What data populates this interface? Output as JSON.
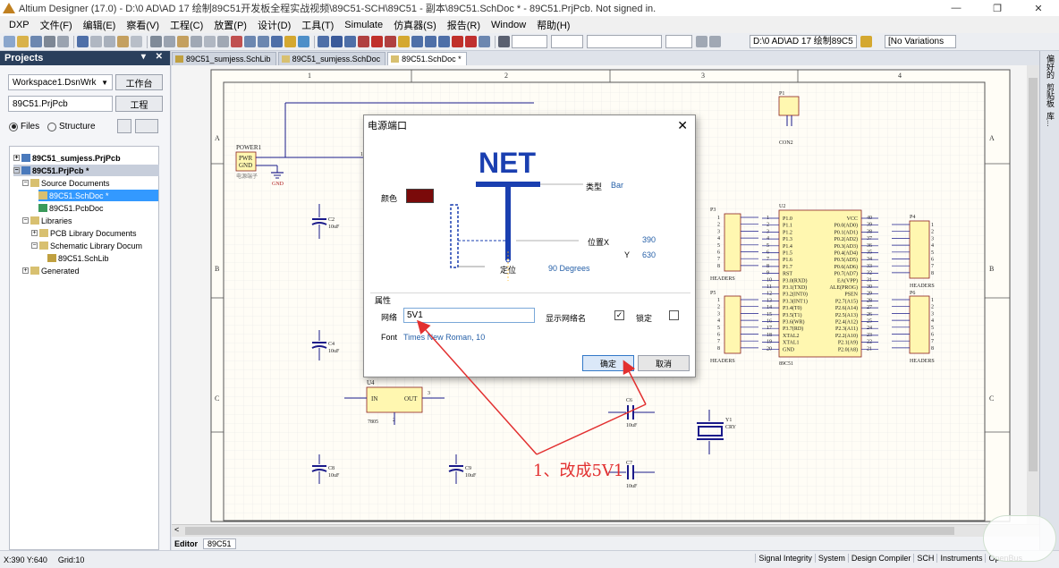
{
  "window": {
    "title": "Altium Designer (17.0) - D:\\0 AD\\AD 17 绘制89C51开发板全程实战视频\\89C51-SCH\\89C51 - 副本\\89C51.SchDoc * - 89C51.PrjPcb. Not signed in.",
    "buttons": [
      "—",
      "❐",
      "✕"
    ]
  },
  "menu": [
    "DXP",
    "文件(F)",
    "编辑(E)",
    "察看(V)",
    "工程(C)",
    "放置(P)",
    "设计(D)",
    "工具(T)",
    "Simulate",
    "仿真器(S)",
    "报告(R)",
    "Window",
    "帮助(H)"
  ],
  "toolbar": {
    "path_combo": "D:\\0 AD\\AD 17 绘制89C5",
    "variations": "[No Variations"
  },
  "projects": {
    "title": "Projects",
    "workspace": "Workspace1.DsnWrk",
    "workspace_btn": "工作台",
    "project": "89C51.PrjPcb",
    "project_btn": "工程",
    "view_files": "Files",
    "view_structure": "Structure",
    "tree": [
      "89C51_sumjess.PrjPcb",
      "89C51.PrjPcb *",
      "Source Documents",
      "89C51.SchDoc *",
      "89C51.PcbDoc",
      "Libraries",
      "PCB Library Documents",
      "Schematic Library Docum",
      "89C51.SchLib",
      "Generated"
    ]
  },
  "tabs": [
    "89C51_sumjess.SchLib",
    "89C51_sumjess.SchDoc",
    "89C51.SchDoc *"
  ],
  "schematic": {
    "zones_top": [
      "1",
      "2",
      "3",
      "4"
    ],
    "zones_side": [
      "A",
      "B",
      "C"
    ],
    "labels": {
      "power1": "POWER1",
      "pwr": "PWR",
      "gnd_pin": "GND",
      "power_sub": "电源端子",
      "gnd": "GND",
      "c2": "C2",
      "c2v": "10uF",
      "c4": "C4",
      "c4v": "10uF",
      "c8": "C8",
      "c8v": "10uF",
      "c9": "C9",
      "c9v": "10uF",
      "c6": "C6",
      "c6v": "10uF",
      "c7": "C7",
      "c7v": "10uF",
      "u4": "U4",
      "u4in": "IN",
      "u4out": "OUT",
      "u4part": "7805",
      "p1": "P1",
      "con2": "CON2",
      "u2": "U2",
      "u2part": "89C51",
      "y1": "Y1",
      "cry": "CRY",
      "p3": "P3",
      "p4": "P4",
      "p5": "P5",
      "p6": "P6",
      "headers": "HEADERS",
      "one": "1",
      "three": "3",
      "two": "2"
    },
    "u2_left_pins": [
      "P1.0",
      "P1.1",
      "P1.2",
      "P1.3",
      "P1.4",
      "P1.5",
      "P1.6",
      "P1.7",
      "RST",
      "P3.0(RXD)",
      "P3.1(TXD)",
      "P3.2(INT0)",
      "P3.3(INT1)",
      "P3.4(T0)",
      "P3.5(T1)",
      "P3.6(WR)",
      "P3.7(RD)",
      "XTAL2",
      "XTAL1",
      "GND"
    ],
    "u2_left_nums": [
      "1",
      "2",
      "3",
      "4",
      "5",
      "6",
      "7",
      "8",
      "9",
      "10",
      "11",
      "12",
      "13",
      "14",
      "15",
      "16",
      "17",
      "18",
      "19",
      "20"
    ],
    "u2_right_pins": [
      "VCC",
      "P0.0(AD0)",
      "P0.1(AD1)",
      "P0.2(AD2)",
      "P0.3(AD3)",
      "P0.4(AD4)",
      "P0.5(AD5)",
      "P0.6(AD6)",
      "P0.7(AD7)",
      "EA(VPP)",
      "ALE(PROG)",
      "PSEN",
      "P2.7(A15)",
      "P2.6(A14)",
      "P2.5(A13)",
      "P2.4(A12)",
      "P2.3(A11)",
      "P2.2(A10)",
      "P2.1(A9)",
      "P2.0(A8)"
    ],
    "u2_right_nums": [
      "40",
      "39",
      "38",
      "37",
      "36",
      "35",
      "34",
      "33",
      "32",
      "31",
      "30",
      "29",
      "28",
      "27",
      "26",
      "25",
      "24",
      "23",
      "22",
      "21"
    ],
    "header_nums": [
      "1",
      "2",
      "3",
      "4",
      "5",
      "6",
      "7",
      "8"
    ]
  },
  "dialog": {
    "title": "电源端口",
    "close": "✕",
    "net_graphic": "NET",
    "color_label": "颜色",
    "color_value": "#7a0a0a",
    "type_label": "类型",
    "type_value": "Bar",
    "posx_label": "位置X",
    "posx_value": "390",
    "posy_label": "Y",
    "posy_value": "630",
    "orient_label": "定位",
    "orient_value": "90 Degrees",
    "props_label": "属性",
    "net_label": "网络",
    "net_value": "5V1",
    "show_net_label": "显示网络名",
    "show_net_checked": "✓",
    "lock_label": "锁定",
    "font_label": "Font",
    "font_value": "Times New Roman, 10",
    "ok": "确定",
    "cancel": "取消"
  },
  "editor": {
    "label": "Editor",
    "tab": "89C51"
  },
  "rightpanel": [
    "偏好的",
    "剪贴板",
    "库..."
  ],
  "status": {
    "coords": "X:390 Y:640",
    "grid": "Grid:10",
    "panels": [
      "Signal Integrity",
      "System",
      "Design Compiler",
      "SCH",
      "Instruments",
      "OpenBus"
    ]
  },
  "annotation": "1、改成5V1"
}
